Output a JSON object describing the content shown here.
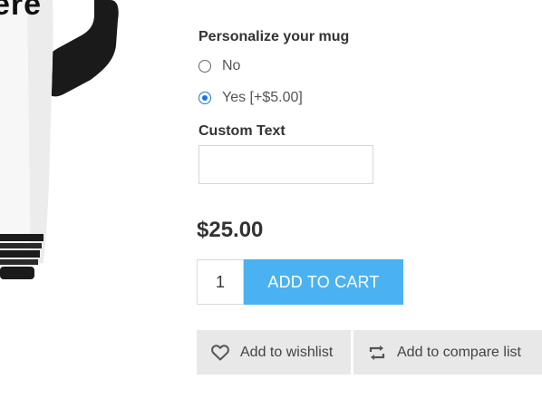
{
  "product": {
    "image_text": "ere"
  },
  "attributes": {
    "personalize": {
      "label": "Personalize your mug",
      "options": [
        {
          "label": "No",
          "selected": false
        },
        {
          "label": "Yes [+$5.00]",
          "selected": true
        }
      ]
    },
    "custom_text": {
      "label": "Custom Text",
      "value": "",
      "placeholder": ""
    }
  },
  "price": "$25.00",
  "cart": {
    "quantity": "1",
    "add_to_cart_label": "ADD TO CART"
  },
  "actions": {
    "wishlist_label": "Add to wishlist",
    "compare_label": "Add to compare list"
  },
  "colors": {
    "accent": "#4ab2f1",
    "radio_selected": "#1a73e8",
    "secondary_button_bg": "#e8e8e8"
  }
}
